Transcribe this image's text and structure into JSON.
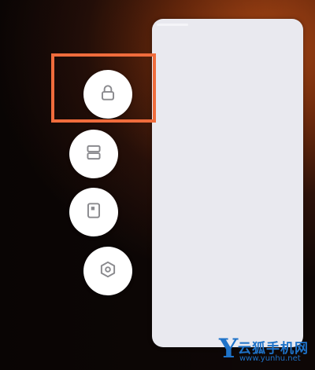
{
  "screen": {
    "description_colors": {
      "highlight": "#f06c3c",
      "button_bg": "#ffffff",
      "icon_color": "#8a8a8e",
      "card_bg": "#e9e9ef",
      "watermark": "#1e72c8"
    }
  },
  "actions": [
    {
      "icon": "lock-icon"
    },
    {
      "icon": "split-screen-icon"
    },
    {
      "icon": "floating-window-icon"
    },
    {
      "icon": "settings-hexagon-icon"
    }
  ],
  "watermark": {
    "logo": "Y",
    "brand": "云狐手机网",
    "url": "www.yunhu.net"
  }
}
